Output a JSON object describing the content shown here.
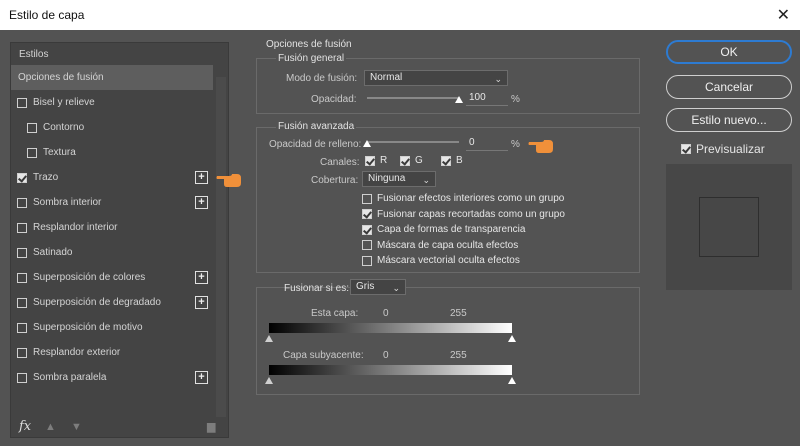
{
  "window": {
    "title": "Estilo de capa",
    "close_glyph": "✕"
  },
  "styles": {
    "header": "Estilos",
    "items": [
      {
        "label": "Opciones de fusión",
        "checkbox": false,
        "checked": false,
        "plus": false,
        "selected": true,
        "indent": false
      },
      {
        "label": "Bisel y relieve",
        "checkbox": true,
        "checked": false,
        "plus": false,
        "selected": false,
        "indent": false
      },
      {
        "label": "Contorno",
        "checkbox": true,
        "checked": false,
        "plus": false,
        "selected": false,
        "indent": true
      },
      {
        "label": "Textura",
        "checkbox": true,
        "checked": false,
        "plus": false,
        "selected": false,
        "indent": true
      },
      {
        "label": "Trazo",
        "checkbox": true,
        "checked": true,
        "plus": true,
        "selected": false,
        "indent": false
      },
      {
        "label": "Sombra interior",
        "checkbox": true,
        "checked": false,
        "plus": true,
        "selected": false,
        "indent": false
      },
      {
        "label": "Resplandor interior",
        "checkbox": true,
        "checked": false,
        "plus": false,
        "selected": false,
        "indent": false
      },
      {
        "label": "Satinado",
        "checkbox": true,
        "checked": false,
        "plus": false,
        "selected": false,
        "indent": false
      },
      {
        "label": "Superposición de colores",
        "checkbox": true,
        "checked": false,
        "plus": true,
        "selected": false,
        "indent": false
      },
      {
        "label": "Superposición de degradado",
        "checkbox": true,
        "checked": false,
        "plus": true,
        "selected": false,
        "indent": false
      },
      {
        "label": "Superposición de motivo",
        "checkbox": true,
        "checked": false,
        "plus": false,
        "selected": false,
        "indent": false
      },
      {
        "label": "Resplandor exterior",
        "checkbox": true,
        "checked": false,
        "plus": false,
        "selected": false,
        "indent": false
      },
      {
        "label": "Sombra paralela",
        "checkbox": true,
        "checked": false,
        "plus": true,
        "selected": false,
        "indent": false
      }
    ],
    "footer": {
      "fx_label": "fx"
    }
  },
  "blending": {
    "section_title": "Opciones de fusión",
    "general": {
      "title": "Fusión general",
      "mode_label": "Modo de fusión:",
      "mode_value": "Normal",
      "opacity_label": "Opacidad:",
      "opacity_value": "100",
      "opacity_level": 1.0,
      "unit": "%"
    },
    "advanced": {
      "title": "Fusión avanzada",
      "fill_label": "Opacidad de relleno:",
      "fill_value": "0",
      "fill_level": 0.0,
      "unit": "%",
      "channels_label": "Canales:",
      "channels": [
        {
          "label": "R",
          "checked": true
        },
        {
          "label": "G",
          "checked": true
        },
        {
          "label": "B",
          "checked": true
        }
      ],
      "knockout_label": "Cobertura:",
      "knockout_value": "Ninguna",
      "options": [
        {
          "label": "Fusionar efectos interiores como un grupo",
          "checked": false
        },
        {
          "label": "Fusionar capas recortadas como un grupo",
          "checked": true
        },
        {
          "label": "Capa de formas de transparencia",
          "checked": true
        },
        {
          "label": "Máscara de capa oculta efectos",
          "checked": false
        },
        {
          "label": "Máscara vectorial oculta efectos",
          "checked": false
        }
      ]
    },
    "blend_if": {
      "label": "Fusionar si es:",
      "value": "Gris",
      "this_layer": {
        "label": "Esta capa:",
        "min": "0",
        "max": "255"
      },
      "underlying": {
        "label": "Capa subyacente:",
        "min": "0",
        "max": "255"
      }
    }
  },
  "buttons": {
    "ok": "OK",
    "cancel": "Cancelar",
    "new_style": "Estilo nuevo...",
    "preview_label": "Previsualizar",
    "preview_checked": true
  },
  "colors": {
    "accent_blue": "#2d7bd2",
    "hand_orange": "#f0903a"
  }
}
